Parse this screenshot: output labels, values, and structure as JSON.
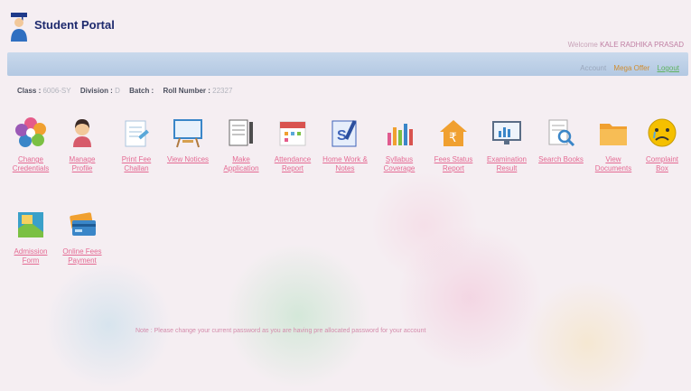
{
  "app": {
    "title": "Student Portal"
  },
  "header": {
    "welcome_prefix": "Welcome",
    "welcome_name": "KALE RADHIKA PRASAD"
  },
  "topbar": {
    "links": [
      "Account",
      "Mega Offer",
      "Logout"
    ]
  },
  "student_info": {
    "class_label": "Class :",
    "class_value": "6006-SY",
    "division_label": "Division :",
    "division_value": "D",
    "batch_label": "Batch :",
    "batch_value": "",
    "roll_label": "Roll Number :",
    "roll_value": "22327"
  },
  "tiles": [
    {
      "label": "Change Credentials",
      "icon": "gear-icon",
      "color": "#d94ea0"
    },
    {
      "label": "Manage Profile",
      "icon": "user-icon",
      "color": "#d75b6b"
    },
    {
      "label": "Print Fee Challan",
      "icon": "challan-icon",
      "color": "#5aa8d9"
    },
    {
      "label": "View Notices",
      "icon": "notice-board-icon",
      "color": "#4a8fd1"
    },
    {
      "label": "Make Application",
      "icon": "application-icon",
      "color": "#555555"
    },
    {
      "label": "Attendance Report",
      "icon": "calendar-icon",
      "color": "#d9534f"
    },
    {
      "label": "Home Work & Notes",
      "icon": "homework-icon",
      "color": "#3d63b8"
    },
    {
      "label": "Syllabus Coverage",
      "icon": "bar-chart-icon",
      "color": "#e05a8f"
    },
    {
      "label": "Fees Status Report",
      "icon": "rupee-house-icon",
      "color": "#f0a030"
    },
    {
      "label": "Examination Result",
      "icon": "monitor-chart-icon",
      "color": "#3a86c8"
    },
    {
      "label": "Search Books",
      "icon": "search-book-icon",
      "color": "#3a86c8"
    },
    {
      "label": "View Documents",
      "icon": "folder-icon",
      "color": "#f0a030"
    },
    {
      "label": "Complaint Box",
      "icon": "sad-face-icon",
      "color": "#f5c000"
    },
    {
      "label": "Admission Form",
      "icon": "admission-icon",
      "color": "#3aa0c9"
    },
    {
      "label": "Online Fees Payment",
      "icon": "card-icon",
      "color": "#3a86c8"
    }
  ],
  "note": "Note : Please change your current password as you are having pre allocated password for your account"
}
